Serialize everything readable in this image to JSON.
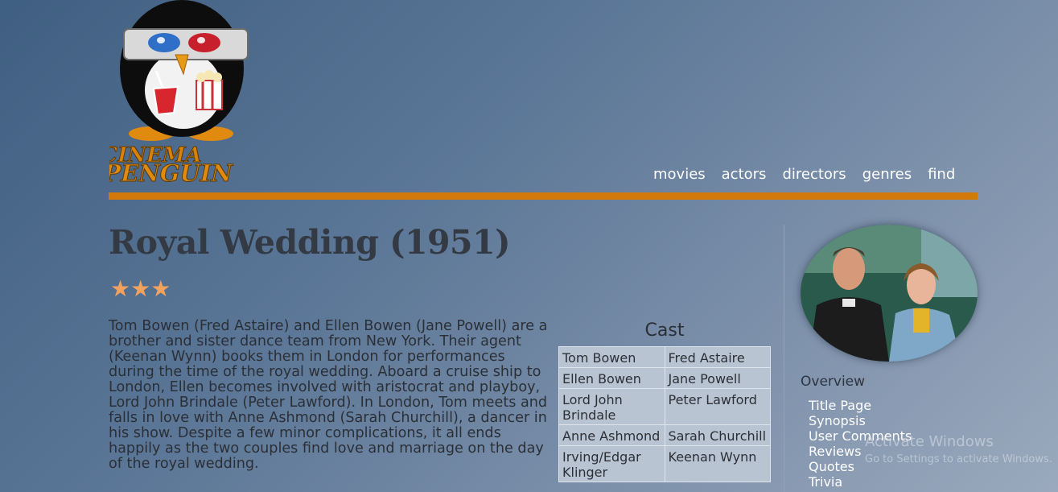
{
  "logo": {
    "line1": "CINEMA",
    "line2": "PENGUIN"
  },
  "nav": [
    "movies",
    "actors",
    "directors",
    "genres",
    "find"
  ],
  "movie": {
    "title": "Royal Wedding (1951)",
    "stars": "★★★",
    "rating": 3,
    "synopsis": "Tom Bowen (Fred Astaire) and Ellen Bowen (Jane Powell) are a brother and sister dance team from New York. Their agent (Keenan Wynn) books them in London for performances during the time of the royal wedding. Aboard a cruise ship to London, Ellen becomes involved with aristocrat and playboy, Lord John Brindale (Peter Lawford). In London, Tom meets and falls in love with Anne Ashmond (Sarah Churchill), a dancer in his show. Despite a few minor complications, it all ends happily as the two couples find love and marriage on the day of the royal wedding."
  },
  "cast": {
    "caption": "Cast",
    "rows": [
      {
        "role": "Tom Bowen",
        "actor": "Fred Astaire"
      },
      {
        "role": "Ellen Bowen",
        "actor": "Jane Powell"
      },
      {
        "role": "Lord John Brindale",
        "actor": "Peter Lawford"
      },
      {
        "role": "Anne Ashmond",
        "actor": "Sarah Churchill"
      },
      {
        "role": "Irving/Edgar Klinger",
        "actor": "Keenan Wynn"
      }
    ]
  },
  "sidebar": {
    "overview": "Overview",
    "links": [
      "Title Page",
      "Synopsis",
      "User Comments",
      "Reviews",
      "Quotes",
      "Trivia"
    ]
  },
  "watermark": {
    "line1": "Activate Windows",
    "line2": "Go to Settings to activate Windows."
  },
  "colors": {
    "accent": "#d3780a",
    "star": "#f0a25e",
    "table_bg": "#b9c4d2"
  }
}
